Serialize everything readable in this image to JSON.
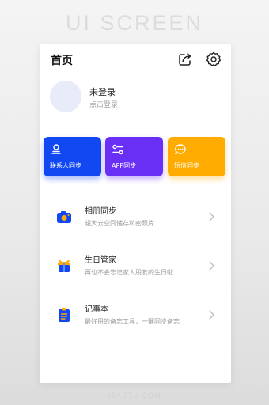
{
  "banner": "UI SCREEN",
  "watermark": "IBAOTU.COM",
  "header": {
    "title": "首页",
    "icons": [
      "share-icon",
      "gear-icon"
    ]
  },
  "profile": {
    "name": "未登录",
    "hint": "点击登录"
  },
  "cards": [
    {
      "label": "联系人同步",
      "color": "#1248f2",
      "icon": "contact-icon"
    },
    {
      "label": "APP同步",
      "color": "#6a2ff4",
      "icon": "toggle-settings-icon"
    },
    {
      "label": "短信同步",
      "color": "#ffab00",
      "icon": "message-icon"
    }
  ],
  "items": [
    {
      "title": "相册同步",
      "subtitle": "超大云空间储存私密照片",
      "icon": "camera-icon"
    },
    {
      "title": "生日管家",
      "subtitle": "再也不会忘记家人朋友的生日啦",
      "icon": "gift-icon"
    },
    {
      "title": "记事本",
      "subtitle": "最好用的备忘工具，一键同步备忘",
      "icon": "clipboard-icon"
    }
  ],
  "colors": {
    "accent_blue": "#1248f2",
    "accent_orange": "#ffab00",
    "accent_purple": "#6a2ff4"
  }
}
